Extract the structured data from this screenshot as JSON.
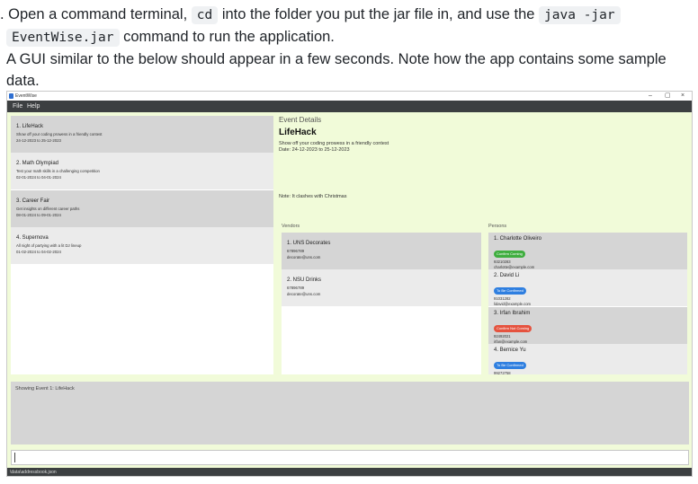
{
  "doc": {
    "line1_a": ". Open a command terminal, ",
    "line1_code1": "cd",
    "line1_b": " into the folder you put the jar file in, and use the ",
    "line1_code2": "java -jar",
    "line2_code": "EventWise.jar",
    "line2_b": " command to run the application.",
    "line3": "A GUI similar to the below should appear in a few seconds. Note how the app contains some sample",
    "line4": "data."
  },
  "app": {
    "window_title": "EventWise",
    "window_controls": {
      "minimize": "–",
      "maximize": "▢",
      "close": "×"
    },
    "menu": {
      "file": "File",
      "help": "Help"
    },
    "events": [
      {
        "name": "1. LifeHack",
        "description": "Show off your coding prowess in a friendly contest",
        "dates": "24-12-2023 to 25-12-2023"
      },
      {
        "name": "2. Math Olympiad",
        "description": "Test your math skills in a challenging competition",
        "dates": "02-01-2024 to 04-01-2024"
      },
      {
        "name": "3. Career Fair",
        "description": "Get insights on different career paths",
        "dates": "08-01-2024 to 09-01-2024"
      },
      {
        "name": "4. Supernova",
        "description": "All night of partying with a lit DJ lineup",
        "dates": "01-02-2024 to 04-02-2024"
      }
    ],
    "details": {
      "header": "Event Details",
      "title": "LifeHack",
      "description": "Show off your coding prowess in a friendly contest",
      "date": "Date: 24-12-2023 to 25-12-2023",
      "note": "Note: It clashes with Christmas"
    },
    "vendors_label": "Vendors",
    "vendors": [
      {
        "name": "1. UNS Decorates",
        "phone": "67896789",
        "email": "decorate@uns.com"
      },
      {
        "name": "2. NSU Drinks",
        "phone": "67896789",
        "email": "decorate@uns.com"
      }
    ],
    "persons_label": "Persons",
    "persons": [
      {
        "name": "1. Charlotte Oliveiro",
        "tag": "Confirm Coming",
        "tag_color": "#3fae3f",
        "phone": "93210283",
        "email": "charlotte@example.com"
      },
      {
        "name": "2. David Li",
        "tag": "To Be Confirmed",
        "tag_color": "#2f7fe0",
        "phone": "91031282",
        "email": "lidavid@example.com"
      },
      {
        "name": "3. Irfan Ibrahim",
        "tag": "Confirm Not Coming",
        "tag_color": "#e5533f",
        "phone": "92492021",
        "email": "irfan@example.com"
      },
      {
        "name": "4. Bernice Yu",
        "tag": "To Be Confirmed",
        "tag_color": "#2f7fe0",
        "phone": "99272758",
        "email": ""
      }
    ],
    "result": "Showing Event 1: LifeHack",
    "command_value": "",
    "status": "\\data\\addressbook.json"
  }
}
